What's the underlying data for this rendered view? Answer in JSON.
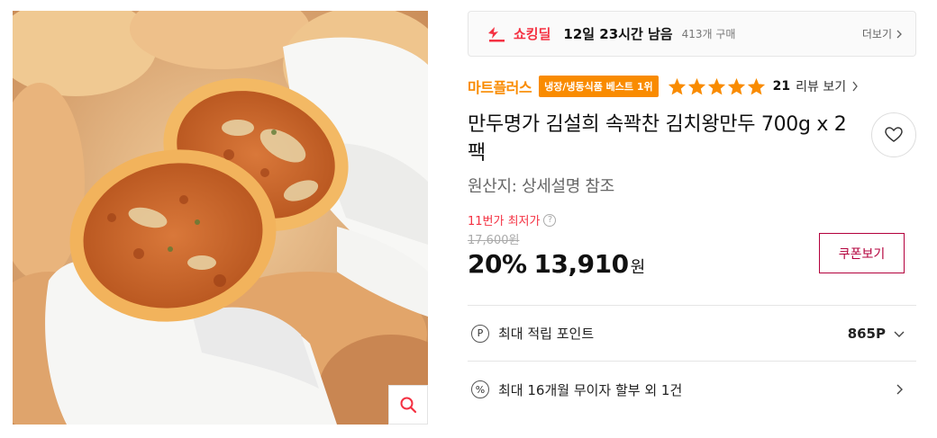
{
  "deal": {
    "name": "쇼킹딜",
    "time_left": "12일 23시간 남음",
    "purchase_count": "413개 구매",
    "more_label": "더보기"
  },
  "brand": {
    "name": "마트플러스",
    "badge": "냉장/냉동식품 베스트 1위"
  },
  "rating": {
    "stars": 5,
    "review_count": "21",
    "review_link_label": "리뷰 보기"
  },
  "product": {
    "title": "만두명가 김설희 속꽉찬 김치왕만두 700g x 2팩",
    "origin": "원산지: 상세설명 참조"
  },
  "price": {
    "lowest_label": "11번가 최저가",
    "help_icon": "?",
    "original": "17,600원",
    "discount": "20%",
    "final": "13,910",
    "currency": "원",
    "coupon_label": "쿠폰보기"
  },
  "info_rows": [
    {
      "icon_symbol": "P",
      "icon": "point-icon",
      "label": "최대 적립 포인트",
      "value": "865P",
      "action_icon": "chevron-down-icon"
    },
    {
      "icon_symbol": "%",
      "icon": "installment-icon",
      "label": "최대 16개월 무이자 할부 외 1건",
      "value": "",
      "action_icon": "chevron-right-icon"
    }
  ],
  "colors": {
    "accent_red": "#f43142",
    "brand_orange": "#f98b00",
    "coupon_border": "#b3003c",
    "star": "#f98b00"
  }
}
